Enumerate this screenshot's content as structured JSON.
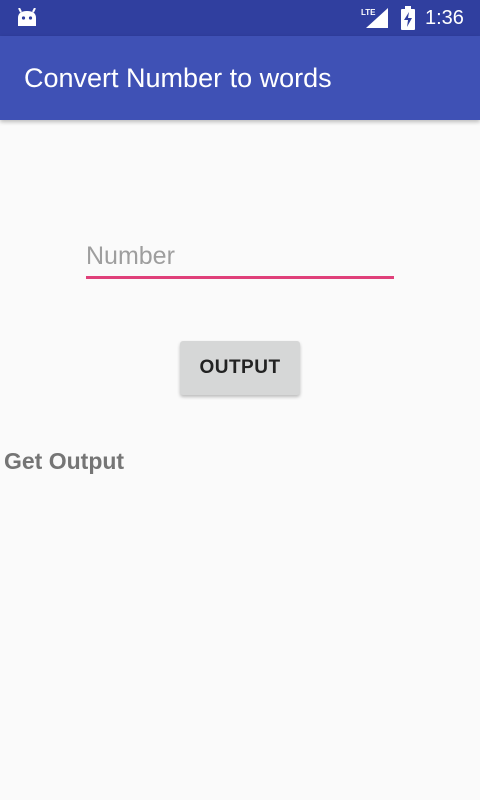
{
  "status_bar": {
    "time": "1:36",
    "network_label": "LTE",
    "icons": [
      "android-icon",
      "lte-signal-icon",
      "battery-charging-icon"
    ],
    "color": "#303f9f"
  },
  "app_bar": {
    "title": "Convert Number to words",
    "color": "#3f51b5"
  },
  "form": {
    "number_placeholder": "Number",
    "number_value": "",
    "underline_color": "#e0407a",
    "output_button_label": "OUTPUT",
    "result_text": "Get Output"
  }
}
